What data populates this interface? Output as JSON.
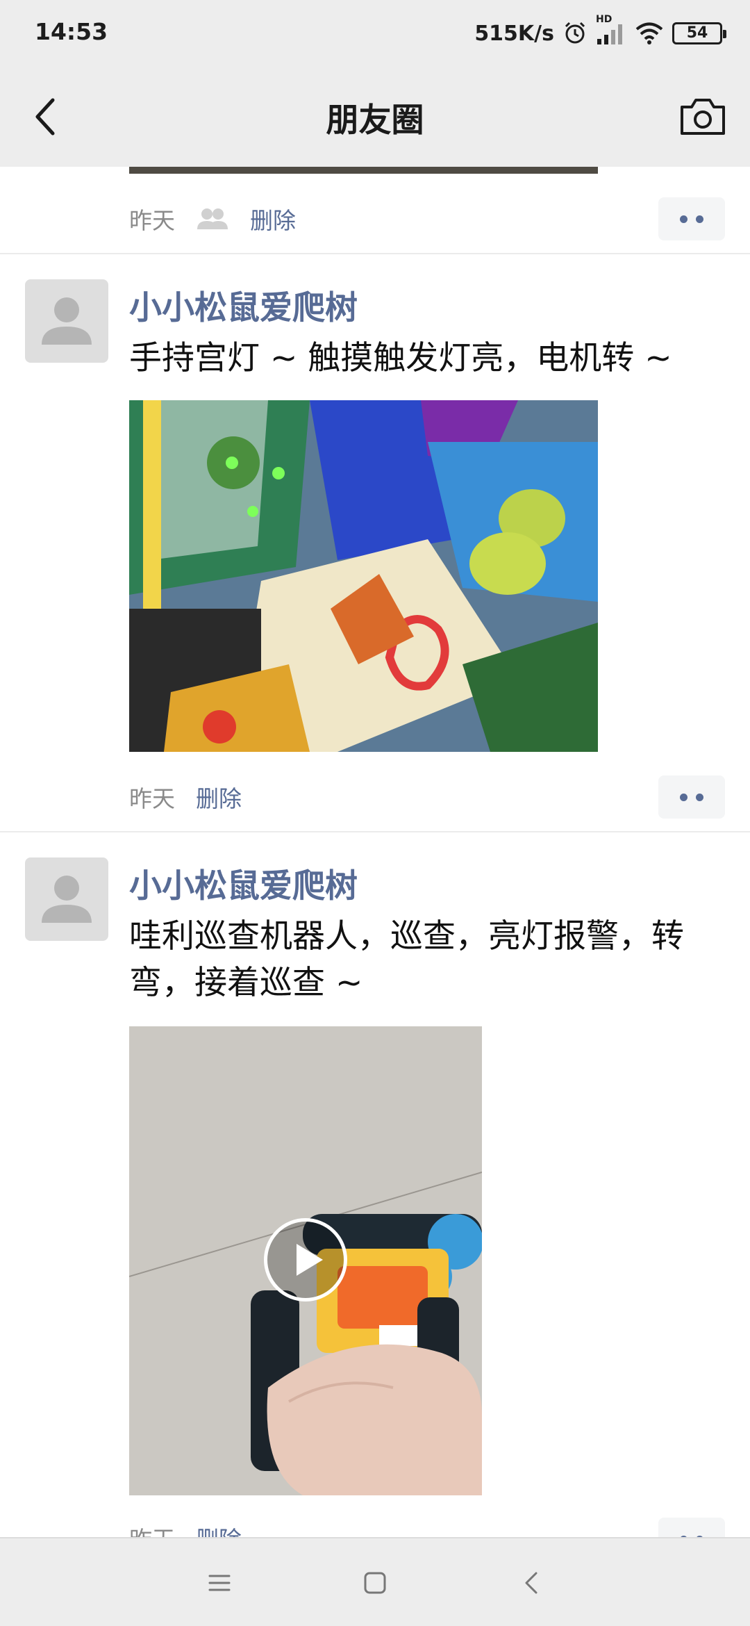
{
  "status_bar": {
    "time": "14:53",
    "network_speed": "515K/s",
    "network_type": "HD",
    "battery": "54",
    "icons": [
      "alarm-icon",
      "signal-icon",
      "wifi-icon",
      "battery-icon"
    ]
  },
  "nav": {
    "title": "朋友圈",
    "back_icon": "chevron-left-icon",
    "camera_icon": "camera-icon"
  },
  "posts": [
    {
      "time": "昨天",
      "visibility_icon": "friends-icon",
      "delete_label": "删除"
    },
    {
      "author": "小小松鼠爱爬树",
      "text": "手持宫灯 ~ 触摸触发灯亮，电机转 ~",
      "media_type": "photo",
      "time": "昨天",
      "delete_label": "删除"
    },
    {
      "author": "小小松鼠爱爬树",
      "text": "哇利巡查机器人，巡查，亮灯报警，转弯，接着巡查 ~",
      "media_type": "video",
      "time": "昨天",
      "delete_label": "删除"
    }
  ],
  "system_nav": [
    "menu-icon",
    "home-icon",
    "back-icon"
  ],
  "colors": {
    "link": "#576b95",
    "background": "#ededed",
    "feed_background": "#ffffff",
    "meta_text": "#8a8a8a"
  }
}
